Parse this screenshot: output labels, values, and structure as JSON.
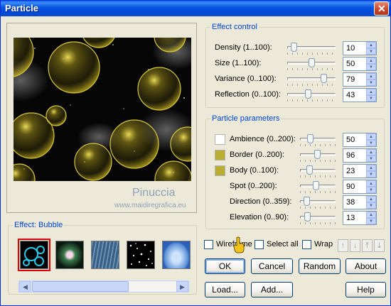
{
  "window": {
    "title": "Particle",
    "close_glyph": "✕"
  },
  "preview": {
    "watermark_name": "Pinuccia",
    "watermark_url": "www.maidiregrafica.eu",
    "bubble_color": "#c8b21e"
  },
  "effect": {
    "legend": "Effect: Bubble",
    "thumbnails": [
      "bubble",
      "sparkle",
      "rain",
      "snow",
      "cloud"
    ],
    "selected_index": 0
  },
  "effect_control": {
    "legend": "Effect control",
    "rows": [
      {
        "label": "Density (1..100):",
        "value": "10",
        "fraction": 0.09
      },
      {
        "label": "Size (1..100):",
        "value": "50",
        "fraction": 0.5
      },
      {
        "label": "Variance (0..100):",
        "value": "79",
        "fraction": 0.79
      },
      {
        "label": "Reflection (0..100):",
        "value": "43",
        "fraction": 0.43
      }
    ]
  },
  "particle_parameters": {
    "legend": "Particle parameters",
    "rows": [
      {
        "label": "Ambience (0..200):",
        "value": "50",
        "fraction": 0.25,
        "swatch": "#ffffff"
      },
      {
        "label": "Border (0..200):",
        "value": "96",
        "fraction": 0.48,
        "swatch": "#b9ad34"
      },
      {
        "label": "Body (0..100):",
        "value": "23",
        "fraction": 0.23,
        "swatch": "#b9ad34"
      },
      {
        "label": "Spot (0..200):",
        "value": "90",
        "fraction": 0.45
      },
      {
        "label": "Direction (0..359):",
        "value": "38",
        "fraction": 0.11
      },
      {
        "label": "Elevation (0..90):",
        "value": "13",
        "fraction": 0.14
      }
    ]
  },
  "options": {
    "wireframe_label": "Wireframe",
    "select_all_label": "Select all",
    "wrap_label": "Wrap"
  },
  "order_arrows": [
    "up-arrow",
    "down-arrow",
    "to-top-arrow",
    "to-bottom-arrow"
  ],
  "buttons": {
    "ok": "OK",
    "cancel": "Cancel",
    "random": "Random",
    "about": "About",
    "load": "Load...",
    "add": "Add...",
    "help": "Help"
  }
}
